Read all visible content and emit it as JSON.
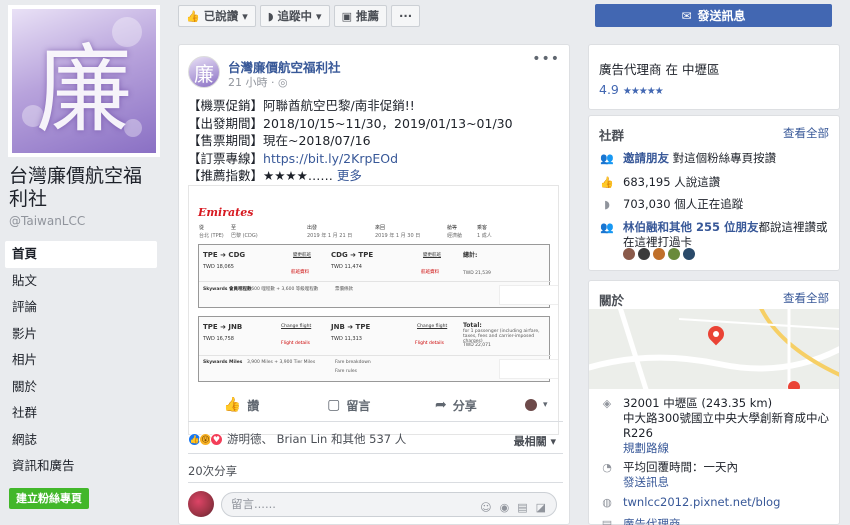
{
  "page": {
    "name": "台灣廉價航空福利社",
    "handle": "@TaiwanLCC",
    "profile_glyph": "廉",
    "create_page_button": "建立粉絲專頁"
  },
  "nav": [
    {
      "label": "首頁",
      "active": true
    },
    {
      "label": "貼文"
    },
    {
      "label": "評論"
    },
    {
      "label": "影片"
    },
    {
      "label": "相片"
    },
    {
      "label": "關於"
    },
    {
      "label": "社群"
    },
    {
      "label": "網誌"
    },
    {
      "label": "資訊和廣告"
    }
  ],
  "toolbar": {
    "liked": "已說讚",
    "following": "追蹤中",
    "recommend": "推薦",
    "more": "···",
    "send_message": "發送訊息"
  },
  "post": {
    "author": "台灣廉價航空福利社",
    "time": "21 小時 · ",
    "lines": [
      "【機票促銷】阿聯酋航空巴黎/南非促銷!!",
      "【出發期間】2018/10/15~11/30，2019/01/13~01/30",
      "【售票期間】現在~2018/07/16"
    ],
    "link_prefix": "【訂票專線】",
    "link": "https://bit.ly/2KrpEOd",
    "rating_prefix": "【推薦指數】",
    "rating": "★★★★…… ",
    "more": "更多",
    "flight_image": {
      "brand": "Emirates",
      "header_labels": [
        "從",
        "至",
        "出發",
        "來回",
        "艙等",
        "乘客"
      ],
      "header_values": [
        "台北 (TPE)",
        "巴黎 (CDG)",
        "2019 年 1 月 21 日",
        "2019 年 1 月 30 日",
        "經濟艙",
        "1 成人"
      ],
      "box1": {
        "leg1_route": "TPE ➜ CDG",
        "leg1_change": "變更航班",
        "leg1_price": "TWD 18,065",
        "leg1_details": "航班資料",
        "leg2_route": "CDG ➜ TPE",
        "leg2_change": "變更航班",
        "leg2_price": "TWD 11,474",
        "leg2_details": "航班資料",
        "total_label": "總計:",
        "total_price": "TWD 21,539",
        "skywards_label": "Skywards 會員哩程數",
        "skywards_text": "3,600 哩程數 + 3,600 等級哩程數",
        "fare_note": "票價條款"
      },
      "box2": {
        "leg1_route": "TPE ➜ JNB",
        "leg1_change": "Change flight",
        "leg1_price": "TWD 16,758",
        "leg1_details": "Flight details",
        "leg2_route": "JNB ➜ TPE",
        "leg2_change": "Change flight",
        "leg2_price": "TWD 11,313",
        "leg2_details": "Flight details",
        "total_label": "Total:",
        "total_note": "for 1 passenger (including airfare, taxes, fees and carrier-imposed charges)",
        "total_price": "TWD 22,071",
        "skywards_label": "Skywards Miles",
        "skywards_text": "3,900 Miles + 3,900 Tier Miles",
        "fare_breakdown": "Fare breakdown",
        "fare_rules": "Fare rules"
      }
    },
    "actions": {
      "like": "讚",
      "comment": "留言",
      "share": "分享"
    },
    "reactions_text": "游明德、 Brian Lin 和其他 537 人",
    "sort_label": "最相關 ▾",
    "shares": "20次分享",
    "comment_placeholder": "留言......"
  },
  "sidebar": {
    "category": "廣告代理商 在 中壢區",
    "rating": "4.9",
    "rating_stars": "★★★★★",
    "community": {
      "title": "社群",
      "see_all": "查看全部",
      "invite_link": "邀請朋友",
      "invite_rest": " 對這個粉絲專頁按讚",
      "likes": "683,195 人說這讚",
      "follows": "703,030 個人正在追蹤",
      "friends_bold": "林伯融和其他 255 位朋友",
      "friends_rest": "都說這裡讚或在這裡打過卡"
    },
    "about": {
      "title": "關於",
      "see_all": "查看全部",
      "address": "32001 中壢區 (243.35 km)",
      "address2": "中大路300號國立中央大學創新育成中心R226",
      "directions": "規劃路線",
      "response": "平均回覆時間：一天內",
      "send_message": "發送訊息",
      "website": "twnlcc2012.pixnet.net/blog",
      "category": "廣告代理商"
    }
  },
  "colors": {
    "brand_blue": "#4267b2",
    "link_blue": "#385898",
    "create_green": "#42b72a",
    "bg": "#e9ebee"
  }
}
